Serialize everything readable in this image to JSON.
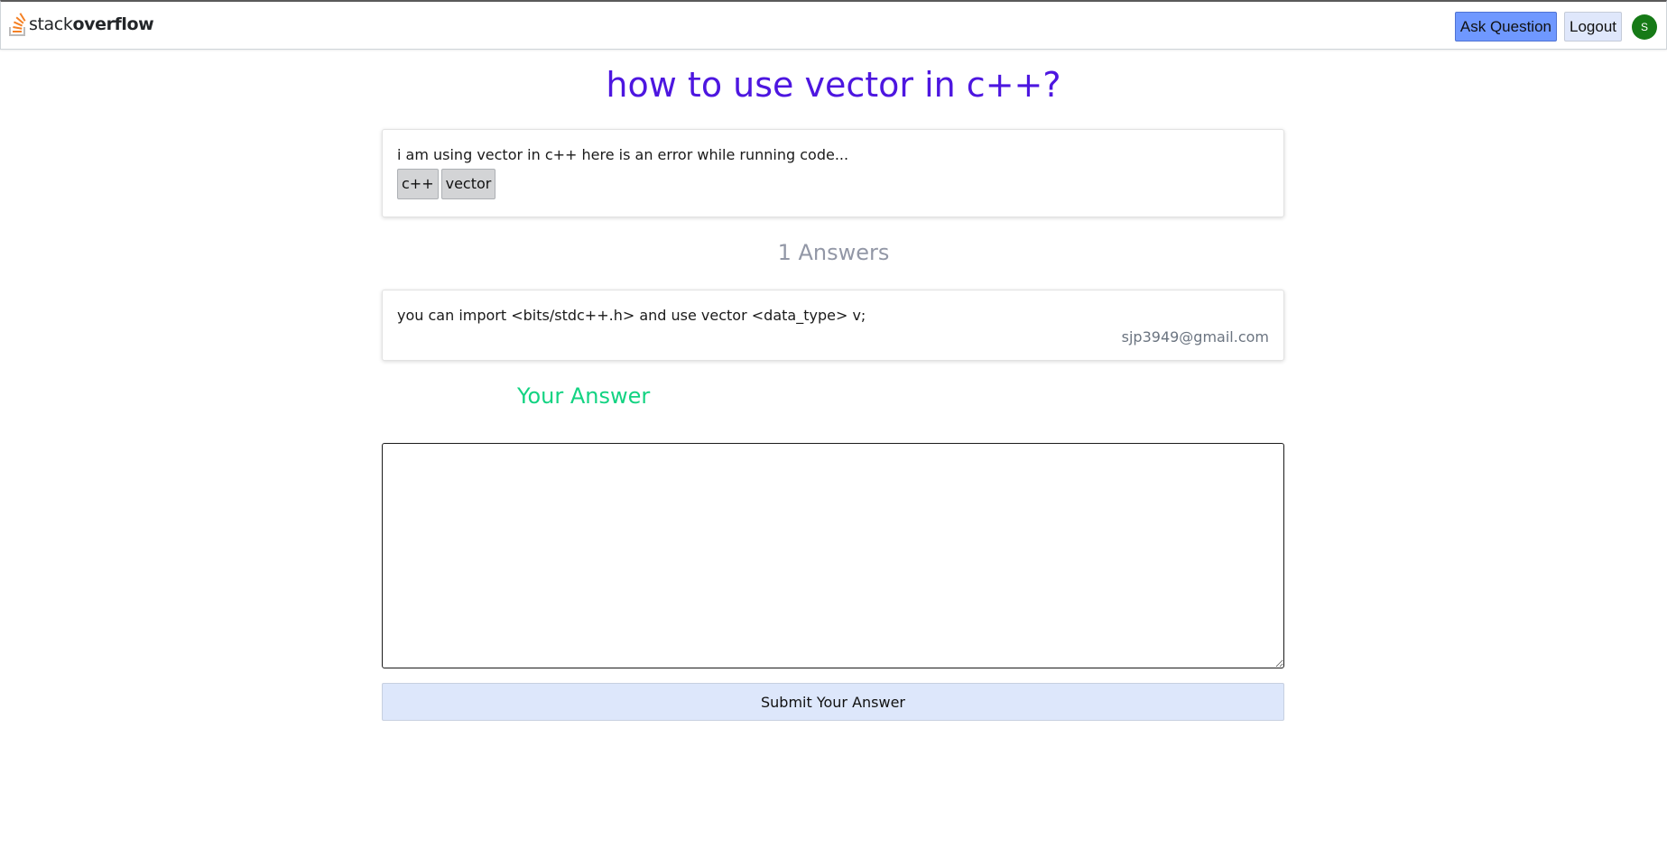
{
  "navbar": {
    "logo_light": "stack",
    "logo_bold": "overflow",
    "ask_label": "Ask Question",
    "logout_label": "Logout",
    "avatar_initial": "S",
    "avatar_color": "#167a17"
  },
  "question": {
    "title": "how to use vector in c++?",
    "body": "i am using vector in c++ here is an error while running code...",
    "tags": [
      "c++",
      "vector"
    ]
  },
  "answers": {
    "heading": "1 Answers",
    "items": [
      {
        "body": "you can import <bits/stdc++.h> and use vector <data_type> v;",
        "author": "sjp3949@gmail.com"
      }
    ]
  },
  "your_answer": {
    "heading": "Your Answer",
    "input_value": "",
    "submit_label": "Submit Your Answer"
  },
  "colors": {
    "title": "#4d16e0",
    "answers_heading": "#9297a6",
    "your_answer_heading": "#13d382",
    "ask_button": "#6f98ff",
    "logo_orange": "#f48024"
  },
  "icons": {
    "logo": "stackoverflow-logo-icon"
  }
}
